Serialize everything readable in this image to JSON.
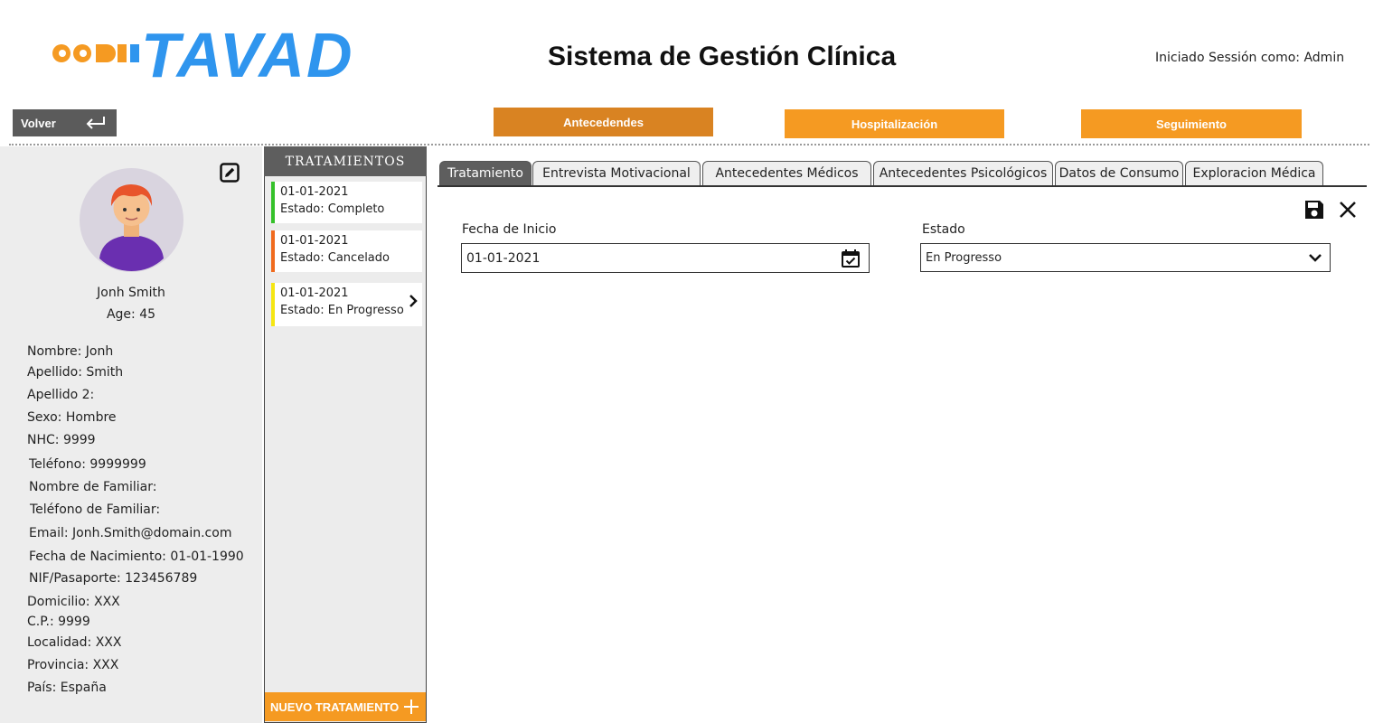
{
  "brand": {
    "logo_text": "TAVAD",
    "dot_colors": [
      "#f59a22",
      "#f59a22",
      "#f59a22"
    ],
    "logo_color": "#2f95ee"
  },
  "header": {
    "title": "Sistema de Gestión Clínica",
    "session_label": "Iniciado Sessión como: Admin"
  },
  "nav": {
    "back_label": "Volver",
    "back_icon": "return-arrow-icon",
    "sections": [
      {
        "label": "Antecedendes",
        "color": "#d98322"
      },
      {
        "label": "Hospitalización",
        "color": "#f59a22"
      },
      {
        "label": "Seguimiento",
        "color": "#f59a22"
      }
    ]
  },
  "patient": {
    "name": "Jonh Smith",
    "age_line": "Age: 45",
    "fields": [
      "Nombre: Jonh",
      "Apellido: Smith",
      "Apellido 2:",
      "Sexo: Hombre",
      "NHC: 9999",
      "Teléfono: 9999999",
      "Nombre de Familiar:",
      "Teléfono de Familiar:",
      "Email: Jonh.Smith@domain.com",
      "Fecha de Nacimiento: 01-01-1990",
      "NIF/Pasaporte: 123456789",
      "Domicilio: XXX",
      "C.P.: 9999",
      "Localidad: XXX",
      "Provincia: XXX",
      "País: España"
    ]
  },
  "treatments": {
    "header": "TRATAMIENTOS",
    "items": [
      {
        "date": "01-01-2021",
        "status": "Estado: Completo",
        "color": "#35c12a",
        "selected": false
      },
      {
        "date": "01-01-2021",
        "status": "Estado: Cancelado",
        "color": "#f06a1e",
        "selected": false
      },
      {
        "date": "01-01-2021",
        "status": "Estado: En Progresso",
        "color": "#f5e612",
        "selected": true
      }
    ],
    "new_label": "NUEVO TRATAMIENTO"
  },
  "tabs": [
    {
      "label": "Tratamiento",
      "active": true
    },
    {
      "label": "Entrevista Motivacional",
      "active": false
    },
    {
      "label": "Antecedentes Médicos",
      "active": false
    },
    {
      "label": "Antecedentes Psicológicos",
      "active": false
    },
    {
      "label": "Datos de Consumo",
      "active": false
    },
    {
      "label": "Exploracion Médica",
      "active": false
    }
  ],
  "form": {
    "start_label": "Fecha de Inicio",
    "start_value": "01-01-2021",
    "state_label": "Estado",
    "state_value": "En Progresso"
  },
  "colors": {
    "accent_orange": "#f59a22",
    "dark_gray": "#5e5e5e",
    "panel_gray": "#ededed"
  }
}
